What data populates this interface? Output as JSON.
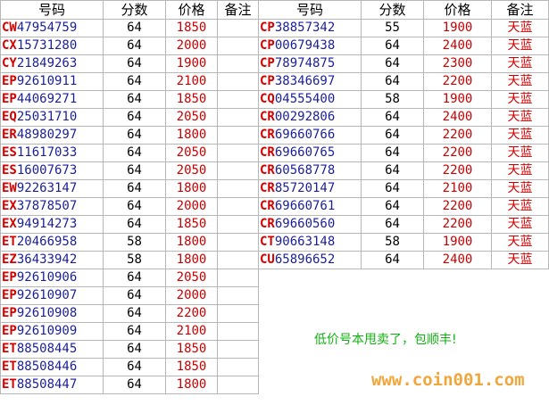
{
  "headers": {
    "left": [
      "号码",
      "分数",
      "价格",
      "备注"
    ],
    "right": [
      "号码",
      "分数",
      "价格",
      "备注"
    ]
  },
  "left_rows": [
    {
      "pre": "CW",
      "num": "47954759",
      "score": "64",
      "price": "1850",
      "note": ""
    },
    {
      "pre": "CX",
      "num": "15731280",
      "score": "64",
      "price": "2000",
      "note": ""
    },
    {
      "pre": "CY",
      "num": "21849263",
      "score": "64",
      "price": "1900",
      "note": ""
    },
    {
      "pre": "EP",
      "num": "92610911",
      "score": "64",
      "price": "2100",
      "note": ""
    },
    {
      "pre": "EP",
      "num": "44069271",
      "score": "64",
      "price": "1850",
      "note": ""
    },
    {
      "pre": "EQ",
      "num": "25031710",
      "score": "64",
      "price": "2050",
      "note": ""
    },
    {
      "pre": "ER",
      "num": "48980297",
      "score": "64",
      "price": "1800",
      "note": ""
    },
    {
      "pre": "ES",
      "num": "11617033",
      "score": "64",
      "price": "2050",
      "note": ""
    },
    {
      "pre": "ES",
      "num": "16007673",
      "score": "64",
      "price": "2050",
      "note": ""
    },
    {
      "pre": "EW",
      "num": "92263147",
      "score": "64",
      "price": "1800",
      "note": ""
    },
    {
      "pre": "EX",
      "num": "37878507",
      "score": "64",
      "price": "2000",
      "note": ""
    },
    {
      "pre": "EX",
      "num": "94914273",
      "score": "64",
      "price": "1850",
      "note": ""
    },
    {
      "pre": "ET",
      "num": "20466958",
      "score": "58",
      "price": "1800",
      "note": ""
    },
    {
      "pre": "EZ",
      "num": "36433942",
      "score": "58",
      "price": "1800",
      "note": ""
    },
    {
      "pre": "EP",
      "num": "92610906",
      "score": "64",
      "price": "2050",
      "note": ""
    },
    {
      "pre": "EP",
      "num": "92610907",
      "score": "64",
      "price": "2000",
      "note": ""
    },
    {
      "pre": "EP",
      "num": "92610908",
      "score": "64",
      "price": "2200",
      "note": ""
    },
    {
      "pre": "EP",
      "num": "92610909",
      "score": "64",
      "price": "2100",
      "note": ""
    },
    {
      "pre": "ET",
      "num": "88508445",
      "score": "64",
      "price": "1850",
      "note": ""
    },
    {
      "pre": "ET",
      "num": "88508446",
      "score": "64",
      "price": "1850",
      "note": ""
    },
    {
      "pre": "ET",
      "num": "88508447",
      "score": "64",
      "price": "1800",
      "note": ""
    }
  ],
  "right_rows": [
    {
      "pre": "CP",
      "num": "38857342",
      "score": "55",
      "price": "1900",
      "note": "天蓝"
    },
    {
      "pre": "CP",
      "num": "00679438",
      "score": "64",
      "price": "2400",
      "note": "天蓝"
    },
    {
      "pre": "CP",
      "num": "78974875",
      "score": "64",
      "price": "2300",
      "note": "天蓝"
    },
    {
      "pre": "CP",
      "num": "38346697",
      "score": "64",
      "price": "2200",
      "note": "天蓝"
    },
    {
      "pre": "CQ",
      "num": "04555400",
      "score": "58",
      "price": "1900",
      "note": "天蓝"
    },
    {
      "pre": "CR",
      "num": "00292806",
      "score": "64",
      "price": "2400",
      "note": "天蓝"
    },
    {
      "pre": "CR",
      "num": "69660766",
      "score": "64",
      "price": "2200",
      "note": "天蓝"
    },
    {
      "pre": "CR",
      "num": "69660765",
      "score": "64",
      "price": "2200",
      "note": "天蓝"
    },
    {
      "pre": "CR",
      "num": "60568778",
      "score": "64",
      "price": "2200",
      "note": "天蓝"
    },
    {
      "pre": "CR",
      "num": "85720147",
      "score": "64",
      "price": "2100",
      "note": "天蓝"
    },
    {
      "pre": "CR",
      "num": "69660761",
      "score": "64",
      "price": "2200",
      "note": "天蓝"
    },
    {
      "pre": "CR",
      "num": "69660560",
      "score": "64",
      "price": "2200",
      "note": "天蓝"
    },
    {
      "pre": "CT",
      "num": "90663148",
      "score": "58",
      "price": "1900",
      "note": "天蓝"
    },
    {
      "pre": "CU",
      "num": "65896652",
      "score": "64",
      "price": "2400",
      "note": "天蓝"
    }
  ],
  "slogan": "低价号本甩卖了，包顺丰!",
  "watermark": "www.coin001.com",
  "colors": {
    "prefix": "#d40000",
    "code": "#1a1f9a",
    "price": "#c80000",
    "slogan": "#10b010",
    "watermark": "#f0a63a"
  }
}
